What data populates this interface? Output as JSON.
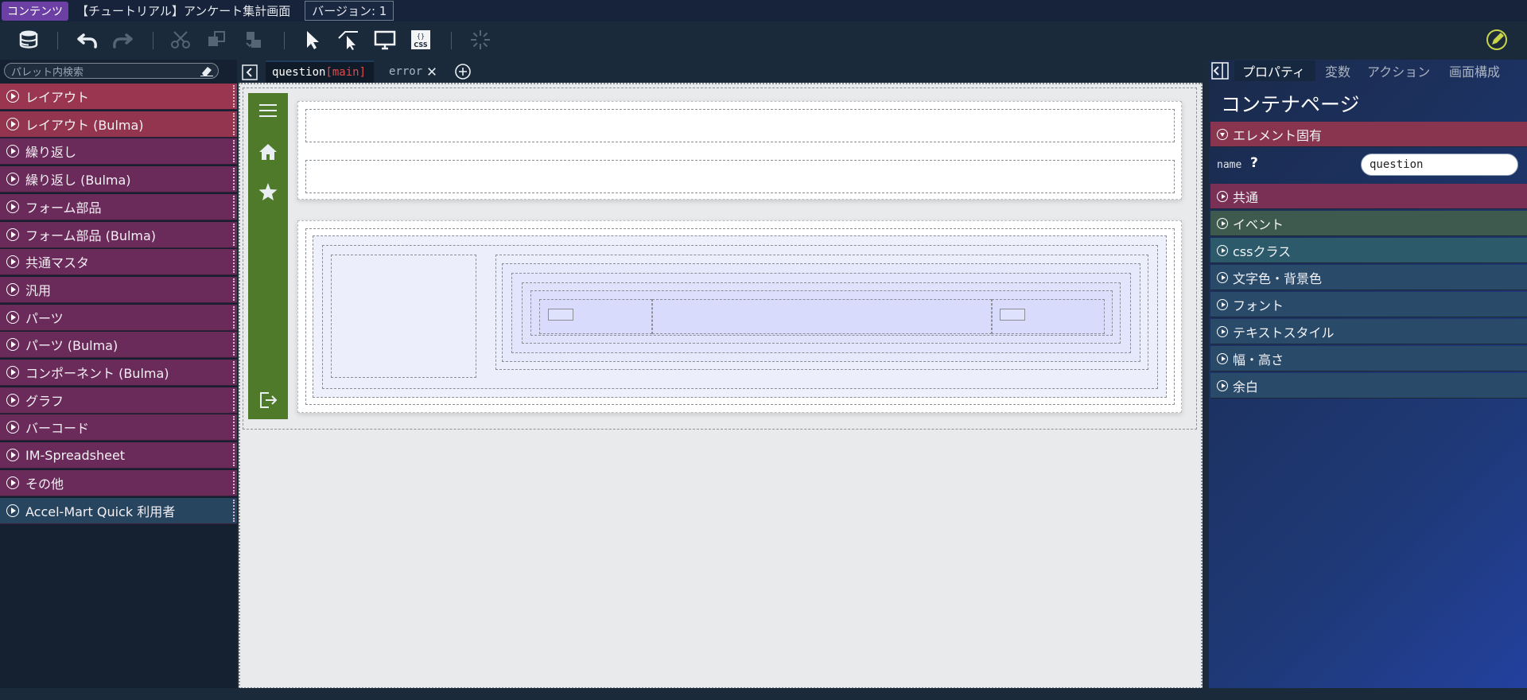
{
  "titlebar": {
    "badge": "コンテンツ",
    "title": "【チュートリアル】アンケート集計画面",
    "version": "バージョン: 1"
  },
  "toolbar": {
    "icons": [
      "database-icon",
      "undo-icon",
      "redo-icon",
      "cut-icon",
      "copy-icon",
      "paste-icon",
      "select-arrow-icon",
      "select-area-icon",
      "monitor-icon",
      "css-icon",
      "loading-icon",
      "edit-pencil-icon"
    ]
  },
  "palette": {
    "search_placeholder": "パレット内検索",
    "categories": [
      {
        "label": "レイアウト",
        "color": "#9a3650"
      },
      {
        "label": "レイアウト (Bulma)",
        "color": "#943550"
      },
      {
        "label": "繰り返し",
        "color": "#6a2a5a"
      },
      {
        "label": "繰り返し (Bulma)",
        "color": "#6a2a5a"
      },
      {
        "label": "フォーム部品",
        "color": "#6a2a5a"
      },
      {
        "label": "フォーム部品 (Bulma)",
        "color": "#6a2a5a"
      },
      {
        "label": "共通マスタ",
        "color": "#6a2a5a"
      },
      {
        "label": "汎用",
        "color": "#6a2a5a"
      },
      {
        "label": "パーツ",
        "color": "#6a2a5a"
      },
      {
        "label": "パーツ (Bulma)",
        "color": "#6a2a5a"
      },
      {
        "label": "コンポーネント (Bulma)",
        "color": "#6a2a5a"
      },
      {
        "label": "グラフ",
        "color": "#6a2a5a"
      },
      {
        "label": "バーコード",
        "color": "#6a2a5a"
      },
      {
        "label": "IM-Spreadsheet",
        "color": "#6a2a5a"
      },
      {
        "label": "その他",
        "color": "#6a2a5a"
      },
      {
        "label": "Accel-Mart Quick 利用者",
        "color": "#284560"
      }
    ]
  },
  "editor": {
    "tab_main_name": "question",
    "tab_main_tag": "[main]",
    "tab_error": "error"
  },
  "props": {
    "tabs": [
      "プロパティ",
      "変数",
      "アクション",
      "画面構成"
    ],
    "title": "コンテナページ",
    "sections": [
      {
        "label": "エレメント固有",
        "color": "#8a3550",
        "open": true
      },
      {
        "label": "共通",
        "color": "#7a3055",
        "open": false
      },
      {
        "label": "イベント",
        "color": "#3e5a4e",
        "open": false
      },
      {
        "label": "cssクラス",
        "color": "#2c5a6a",
        "open": false
      },
      {
        "label": "文字色・背景色",
        "color": "#2a4a6a",
        "open": false
      },
      {
        "label": "フォント",
        "color": "#2a4a6a",
        "open": false
      },
      {
        "label": "テキストスタイル",
        "color": "#2a4a6a",
        "open": false
      },
      {
        "label": "幅・高さ",
        "color": "#2a4a6a",
        "open": false
      },
      {
        "label": "余白",
        "color": "#2a4a6a",
        "open": false
      }
    ],
    "name_label": "name",
    "name_help": "?",
    "name_value": "question"
  }
}
